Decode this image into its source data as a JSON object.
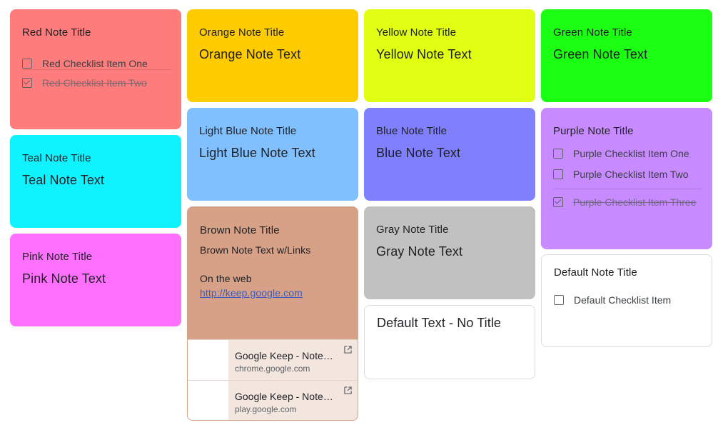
{
  "colors": {
    "red": "#f28b82",
    "orange": "#fccb00",
    "yellow": "#e0ff12",
    "green": "#1bff12",
    "teal": "#0ff2ff",
    "light_blue": "#80c0ff",
    "blue": "#8080ff",
    "purple": "#c88aff",
    "pink": "#ff70ff",
    "brown": "#d7a187",
    "gray": "#c1c1c1",
    "default": "#ffffff"
  },
  "notes": {
    "red": {
      "title": "Red Note Title",
      "items": [
        {
          "label": "Red Checklist Item One",
          "checked": false
        },
        {
          "label": "Red Checklist Item Two",
          "checked": true
        }
      ]
    },
    "orange": {
      "title": "Orange Note Title",
      "text": "Orange Note Text"
    },
    "yellow": {
      "title": "Yellow Note Title",
      "text": "Yellow Note Text"
    },
    "green": {
      "title": "Green Note Title",
      "text": "Green Note Text"
    },
    "teal": {
      "title": "Teal Note Title",
      "text": "Teal Note Text"
    },
    "light_blue": {
      "title": "Light Blue Note Title",
      "text": "Light Blue Note Text"
    },
    "blue": {
      "title": "Blue Note Title",
      "text": "Blue Note Text"
    },
    "purple": {
      "title": "Purple Note Title",
      "items": [
        {
          "label": "Purple Checklist Item One",
          "checked": false
        },
        {
          "label": "Purple Checklist Item Two",
          "checked": false
        },
        {
          "label": "Purple Checklist Item Three",
          "checked": true
        }
      ]
    },
    "pink": {
      "title": "Pink Note Title",
      "text": "Pink Note Text"
    },
    "brown": {
      "title": "Brown Note Title",
      "text": "Brown Note Text w/Links",
      "web_label": "On the web",
      "link": "http://keep.google.com",
      "previews": [
        {
          "title": "Google Keep - Notes and Lists",
          "domain": "chrome.google.com",
          "icon": "open-in-new-icon"
        },
        {
          "title": "Google Keep - Notes and Lists",
          "domain": "play.google.com",
          "icon": "open-in-new-icon"
        }
      ]
    },
    "gray": {
      "title": "Gray Note Title",
      "text": "Gray Note Text"
    },
    "default_text": {
      "text": "Default Text - No Title"
    },
    "default_checklist": {
      "title": "Default Note Title",
      "items": [
        {
          "label": "Default Checklist Item",
          "checked": false
        }
      ]
    }
  }
}
